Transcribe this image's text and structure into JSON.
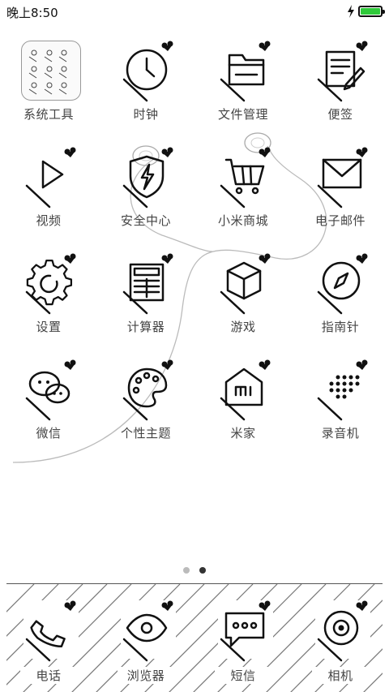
{
  "status_bar": {
    "time": "晚上8:50",
    "battery_color": "#2fc93a"
  },
  "apps": [
    {
      "label": "系统工具",
      "icon": "folder-icon"
    },
    {
      "label": "时钟",
      "icon": "clock-icon"
    },
    {
      "label": "文件管理",
      "icon": "folder-open-icon"
    },
    {
      "label": "便签",
      "icon": "notes-icon"
    },
    {
      "label": "视频",
      "icon": "play-icon"
    },
    {
      "label": "安全中心",
      "icon": "shield-icon"
    },
    {
      "label": "小米商城",
      "icon": "cart-icon"
    },
    {
      "label": "电子邮件",
      "icon": "mail-icon"
    },
    {
      "label": "设置",
      "icon": "gear-icon"
    },
    {
      "label": "计算器",
      "icon": "calculator-icon"
    },
    {
      "label": "游戏",
      "icon": "cube-icon"
    },
    {
      "label": "指南针",
      "icon": "compass-icon"
    },
    {
      "label": "微信",
      "icon": "chat-icon"
    },
    {
      "label": "个性主题",
      "icon": "palette-icon"
    },
    {
      "label": "米家",
      "icon": "home-icon"
    },
    {
      "label": "录音机",
      "icon": "recorder-icon"
    }
  ],
  "page_indicator": {
    "current": 2,
    "total": 2
  },
  "dock": [
    {
      "label": "电话",
      "icon": "phone-icon"
    },
    {
      "label": "浏览器",
      "icon": "eye-icon"
    },
    {
      "label": "短信",
      "icon": "message-icon"
    },
    {
      "label": "相机",
      "icon": "camera-icon"
    }
  ]
}
